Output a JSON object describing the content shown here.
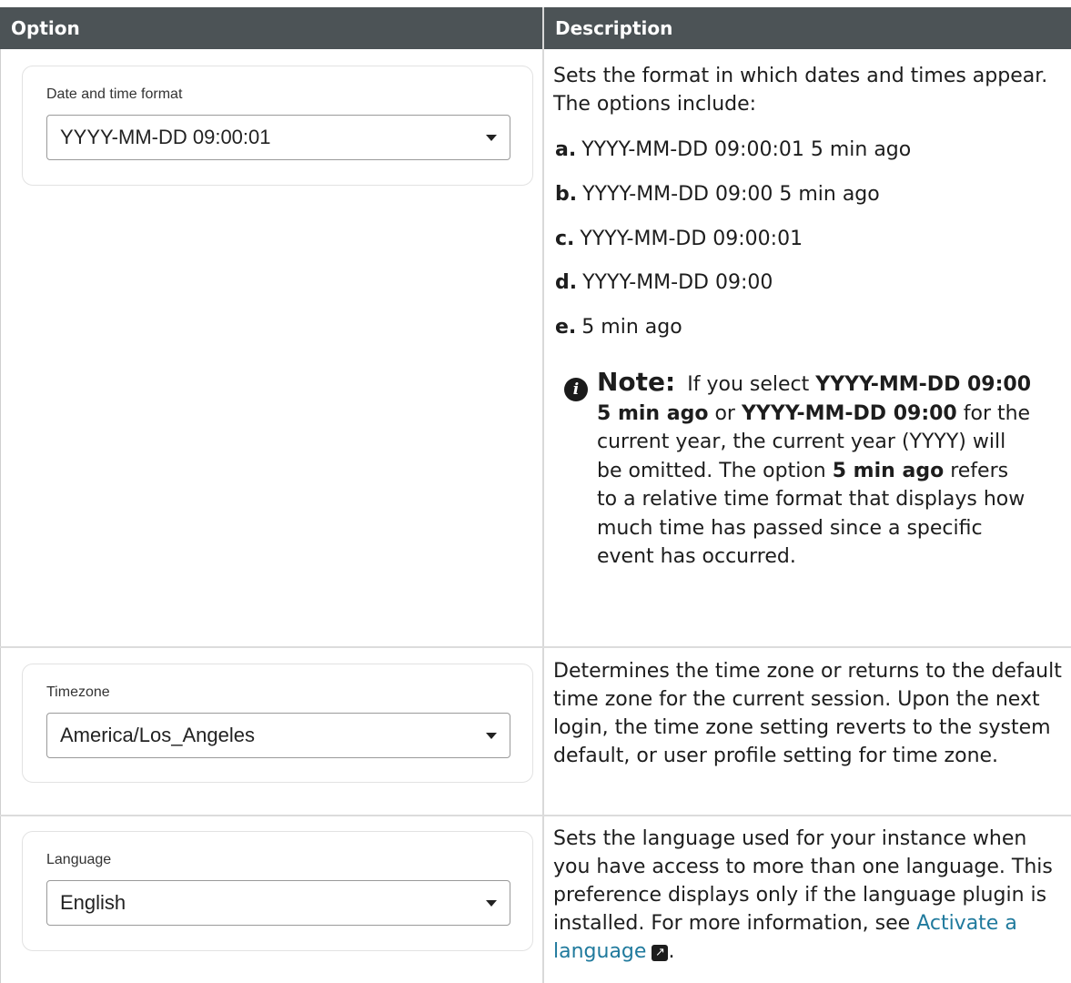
{
  "table": {
    "headers": {
      "option": "Option",
      "description": "Description"
    }
  },
  "rows": [
    {
      "field_label": "Date and time format",
      "field_value": "YYYY-MM-DD 09:00:01",
      "description": "Sets the format in which dates and times appear. The options include:",
      "options": [
        {
          "marker": "a.",
          "text": "YYYY-MM-DD 09:00:01 5 min ago"
        },
        {
          "marker": "b.",
          "text": "YYYY-MM-DD 09:00 5 min ago"
        },
        {
          "marker": "c.",
          "text": "YYYY-MM-DD 09:00:01"
        },
        {
          "marker": "d.",
          "text": "YYYY-MM-DD 09:00"
        },
        {
          "marker": "e.",
          "text": "5 min ago"
        }
      ],
      "note": {
        "icon": "info-icon",
        "title": "Note:",
        "t1": "If you select",
        "b1": "YYYY-MM-DD 09:00 5 min ago",
        "t2": "or",
        "b2": "YYYY-MM-DD 09:00",
        "t3": "for the current year, the current year (YYYY) will be omitted. The option",
        "b3": "5 min ago",
        "t4": "refers to a relative time format that displays how much time has passed since a specific event has occurred."
      }
    },
    {
      "field_label": "Timezone",
      "field_value": "America/Los_Angeles",
      "description": "Determines the time zone or returns to the default time zone for the current session. Upon the next login, the time zone setting reverts to the system default, or user profile setting for time zone."
    },
    {
      "field_label": "Language",
      "field_value": "English",
      "description_before": "Sets the language used for your instance when you have access to more than one language. This preference displays only if the language plugin is installed. For more information, see",
      "link_text": "Activate a language",
      "link_icon": "external-link-icon",
      "description_after": "."
    }
  ],
  "colors": {
    "header_bg": "#4c5356",
    "link": "#207a9d"
  }
}
